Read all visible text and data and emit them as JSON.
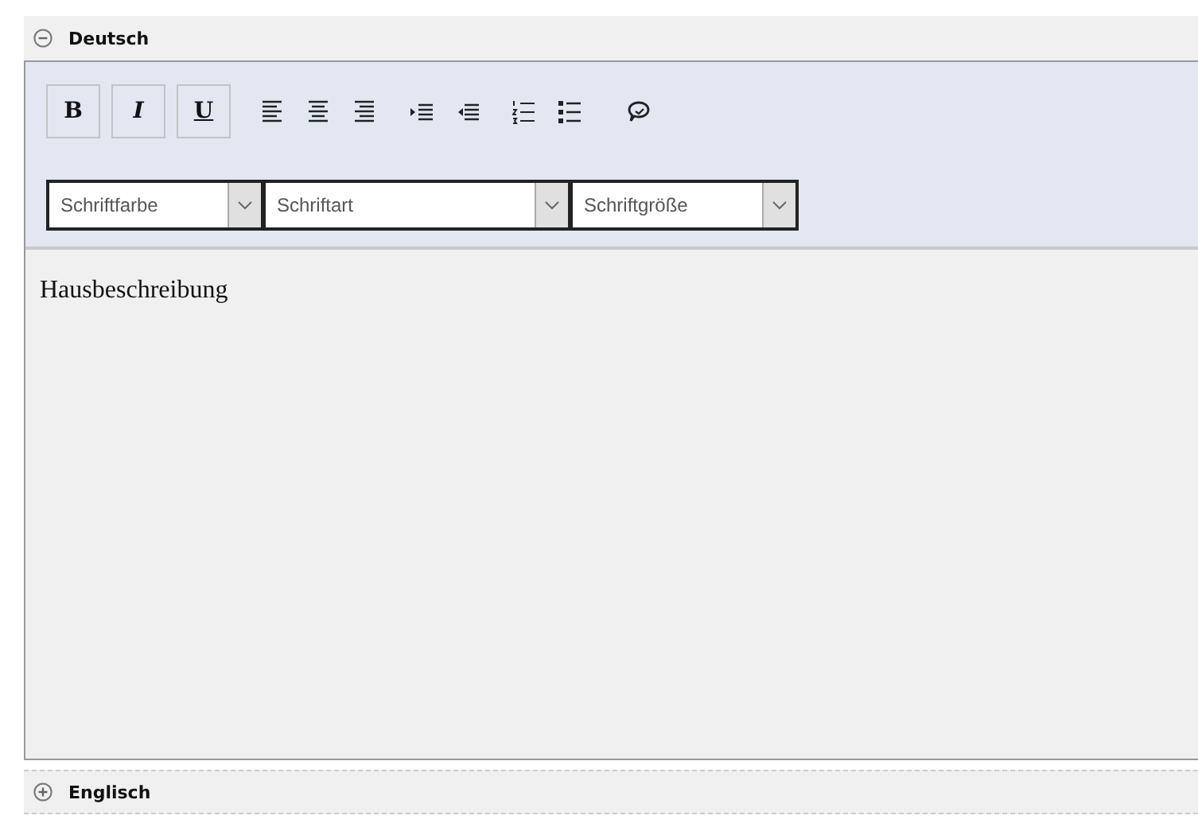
{
  "sections": [
    {
      "title": "Deutsch",
      "expanded": true,
      "editor": {
        "format_buttons": [
          {
            "label": "B",
            "kind": "bold"
          },
          {
            "label": "I",
            "kind": "italic"
          },
          {
            "label": "U",
            "kind": "underline"
          }
        ],
        "tools": [
          {
            "kind": "align-left"
          },
          {
            "kind": "align-center"
          },
          {
            "kind": "align-right"
          },
          {
            "kind": "indent"
          },
          {
            "kind": "outdent"
          },
          {
            "kind": "ordered-list"
          },
          {
            "kind": "bullet-list"
          },
          {
            "kind": "link"
          }
        ],
        "dropdowns": [
          {
            "placeholder": "Schriftfarbe"
          },
          {
            "placeholder": "Schriftart"
          },
          {
            "placeholder": "Schriftgröße"
          }
        ],
        "content": "Hausbeschreibung"
      }
    },
    {
      "title": "Englisch",
      "expanded": false
    }
  ]
}
